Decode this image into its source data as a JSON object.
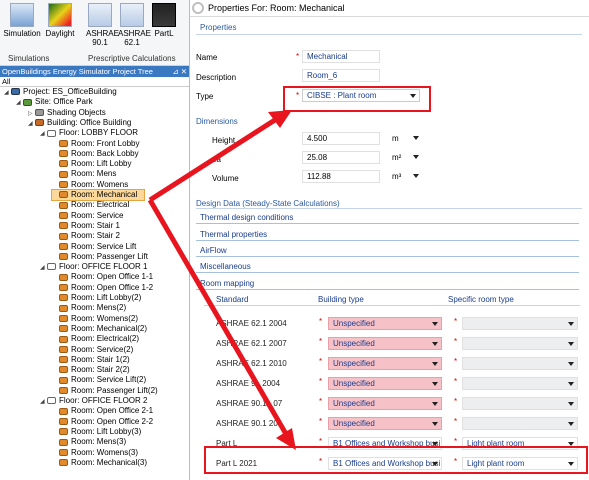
{
  "ribbon": {
    "buttons": [
      {
        "label": "Simulation"
      },
      {
        "label": "Daylight"
      },
      {
        "label": "ASHRAE",
        "sub": "90.1"
      },
      {
        "label": "ASHRAE",
        "sub": "62.1"
      },
      {
        "label": "PartL"
      }
    ],
    "groups": [
      "Simulations",
      "Prescriptive Calculations"
    ]
  },
  "tree": {
    "header": "OpenBuildings Energy Simulator Project Tree",
    "pin": "⊿ ✕",
    "filter": "All",
    "nodes": [
      {
        "label": "Project: ES_OfficeBuilding",
        "type": "proj",
        "indent": 0,
        "tog": "◢"
      },
      {
        "label": "Site: Office Park",
        "type": "site",
        "indent": 1,
        "tog": "◢"
      },
      {
        "label": "Shading Objects",
        "type": "shade",
        "indent": 2,
        "tog": "▷"
      },
      {
        "label": "Building: Office Building",
        "type": "bld",
        "indent": 2,
        "tog": "◢"
      },
      {
        "label": "Floor: LOBBY FLOOR",
        "type": "floor",
        "indent": 3,
        "tog": "◢"
      },
      {
        "label": "Room: Front Lobby",
        "type": "room",
        "indent": 4,
        "tog": ""
      },
      {
        "label": "Room: Back Lobby",
        "type": "room",
        "indent": 4,
        "tog": ""
      },
      {
        "label": "Room: Lift Lobby",
        "type": "room",
        "indent": 4,
        "tog": ""
      },
      {
        "label": "Room: Mens",
        "type": "room",
        "indent": 4,
        "tog": ""
      },
      {
        "label": "Room: Womens",
        "type": "room",
        "indent": 4,
        "tog": ""
      },
      {
        "label": "Room: Mechanical",
        "type": "room",
        "indent": 4,
        "tog": "",
        "selected": true
      },
      {
        "label": "Room: Electrical",
        "type": "room",
        "indent": 4,
        "tog": ""
      },
      {
        "label": "Room: Service",
        "type": "room",
        "indent": 4,
        "tog": ""
      },
      {
        "label": "Room: Stair 1",
        "type": "room",
        "indent": 4,
        "tog": ""
      },
      {
        "label": "Room: Stair 2",
        "type": "room",
        "indent": 4,
        "tog": ""
      },
      {
        "label": "Room: Service Lift",
        "type": "room",
        "indent": 4,
        "tog": ""
      },
      {
        "label": "Room: Passenger Lift",
        "type": "room",
        "indent": 4,
        "tog": ""
      },
      {
        "label": "Floor: OFFICE FLOOR 1",
        "type": "floor",
        "indent": 3,
        "tog": "◢"
      },
      {
        "label": "Room: Open Office 1-1",
        "type": "room",
        "indent": 4,
        "tog": ""
      },
      {
        "label": "Room: Open Office 1-2",
        "type": "room",
        "indent": 4,
        "tog": ""
      },
      {
        "label": "Room: Lift Lobby(2)",
        "type": "room",
        "indent": 4,
        "tog": ""
      },
      {
        "label": "Room: Mens(2)",
        "type": "room",
        "indent": 4,
        "tog": ""
      },
      {
        "label": "Room: Womens(2)",
        "type": "room",
        "indent": 4,
        "tog": ""
      },
      {
        "label": "Room: Mechanical(2)",
        "type": "room",
        "indent": 4,
        "tog": ""
      },
      {
        "label": "Room: Electrical(2)",
        "type": "room",
        "indent": 4,
        "tog": ""
      },
      {
        "label": "Room: Service(2)",
        "type": "room",
        "indent": 4,
        "tog": ""
      },
      {
        "label": "Room: Stair 1(2)",
        "type": "room",
        "indent": 4,
        "tog": ""
      },
      {
        "label": "Room: Stair 2(2)",
        "type": "room",
        "indent": 4,
        "tog": ""
      },
      {
        "label": "Room: Service Lift(2)",
        "type": "room",
        "indent": 4,
        "tog": ""
      },
      {
        "label": "Room: Passenger Lift(2)",
        "type": "room",
        "indent": 4,
        "tog": ""
      },
      {
        "label": "Floor: OFFICE FLOOR 2",
        "type": "floor",
        "indent": 3,
        "tog": "◢"
      },
      {
        "label": "Room: Open Office 2-1",
        "type": "room",
        "indent": 4,
        "tog": ""
      },
      {
        "label": "Room: Open Office 2-2",
        "type": "room",
        "indent": 4,
        "tog": ""
      },
      {
        "label": "Room: Lift Lobby(3)",
        "type": "room",
        "indent": 4,
        "tog": ""
      },
      {
        "label": "Room: Mens(3)",
        "type": "room",
        "indent": 4,
        "tog": ""
      },
      {
        "label": "Room: Womens(3)",
        "type": "room",
        "indent": 4,
        "tog": ""
      },
      {
        "label": "Room: Mechanical(3)",
        "type": "room",
        "indent": 4,
        "tog": ""
      }
    ]
  },
  "props": {
    "title": "Properties For: Room: Mechanical",
    "section_properties": "Properties",
    "name_label": "Name",
    "name_value": "Mechanical",
    "desc_label": "Description",
    "desc_value": "Room_6",
    "type_label": "Type",
    "type_value": "CIBSE : Plant room",
    "dimensions": "Dimensions",
    "height_label": "Height",
    "height_value": "4.500",
    "height_unit": "m",
    "area_label": "ea",
    "area_value": "25.08",
    "area_unit": "m²",
    "volume_label": "Volume",
    "volume_value": "112.88",
    "volume_unit": "m³",
    "design_data": "Design Data (Steady-State Calculations)",
    "accordions": [
      "Thermal design conditions",
      "Thermal properties",
      "AirFlow",
      "Miscellaneous",
      "Room mapping"
    ],
    "req": "*",
    "map_headers": {
      "standard": "Standard",
      "building": "Building type",
      "room": "Specific room type"
    },
    "map_rows": [
      {
        "standard": "ASHRAE 62.1 2004",
        "building": "Unspecified",
        "room": "",
        "pink": true
      },
      {
        "standard": "ASHRAE 62.1 2007",
        "building": "Unspecified",
        "room": "",
        "pink": true
      },
      {
        "standard": "ASHRAE 62.1 2010",
        "building": "Unspecified",
        "room": "",
        "pink": true
      },
      {
        "standard": "ASHRAE 9 . 2004",
        "building": "Unspecified",
        "room": "",
        "pink": true
      },
      {
        "standard": "ASHRAE 90.1 . 07",
        "building": "Unspecified",
        "room": "",
        "pink": true
      },
      {
        "standard": "ASHRAE 90.1 201",
        "building": "Unspecified",
        "room": "",
        "pink": true
      },
      {
        "standard": "Part L",
        "building": "B1 Offices and Workshop busi",
        "room": "Light plant room",
        "pink": false
      },
      {
        "standard": "Part L 2021",
        "building": "B1 Offices and Workshop busi",
        "room": "Light plant room",
        "pink": false
      }
    ]
  },
  "colors": {
    "accent": "#2a5aa0",
    "highlight": "#e8141e",
    "selected": "#fcd89a",
    "tree_header": "#3b78c2"
  }
}
